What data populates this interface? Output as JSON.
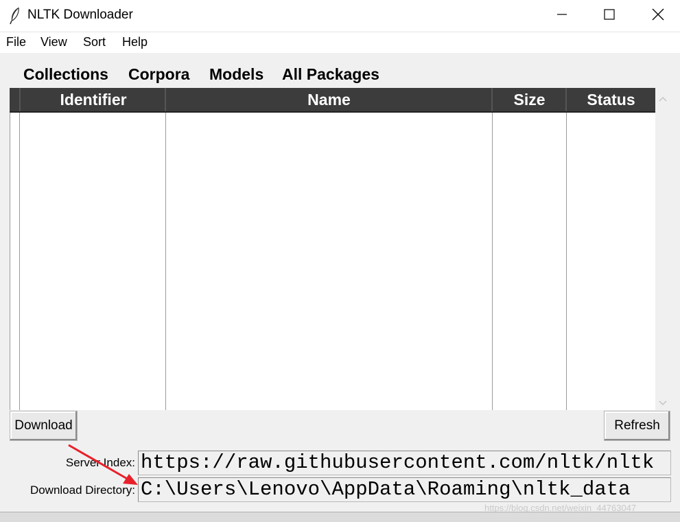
{
  "window": {
    "title": "NLTK Downloader"
  },
  "menu": {
    "items": [
      "File",
      "View",
      "Sort",
      "Help"
    ]
  },
  "tabs": [
    "Collections",
    "Corpora",
    "Models",
    "All Packages"
  ],
  "table": {
    "columns": [
      "Identifier",
      "Name",
      "Size",
      "Status"
    ],
    "rows": []
  },
  "buttons": {
    "download": "Download",
    "refresh": "Refresh"
  },
  "server_index": {
    "label": "Server Index:",
    "value": "https://raw.githubusercontent.com/nltk/nltk"
  },
  "download_directory": {
    "label": "Download Directory:",
    "value": "C:\\Users\\Lenovo\\AppData\\Roaming\\nltk_data"
  },
  "watermark": "https://blog.csdn.net/weixin_44763047",
  "colors": {
    "header_bg": "#3c3c3c",
    "arrow": "#e8202a"
  }
}
